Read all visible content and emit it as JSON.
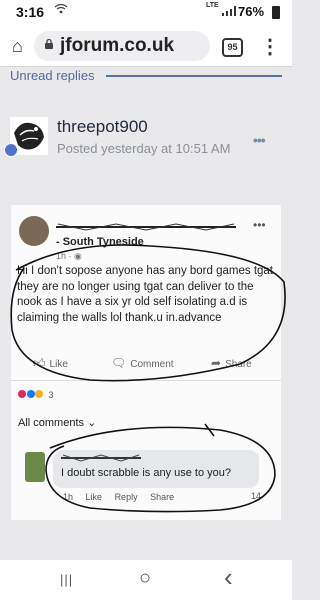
{
  "status_bar": {
    "time": "3:16",
    "network": "LTE",
    "battery": "76%",
    "wifi_icon": "wifi-icon",
    "signal_icon": "signal-icon",
    "battery_icon": "battery-icon"
  },
  "browser": {
    "url": "jforum.co.uk",
    "tab_count": "95",
    "home_icon": "home-icon",
    "lock_icon": "lock-icon",
    "menu_icon": "more-vert-icon"
  },
  "thread": {
    "unread_label": "Unread replies"
  },
  "post": {
    "author": "threepot900",
    "posted": "Posted yesterday at 10:51 AM",
    "options_icon": "ellipsis-icon"
  },
  "fb_screenshot": {
    "location": "- South Tyneside",
    "time": "1h · ",
    "text": "Hi I don't sopose anyone has any bord games tgat they are no longer using tgat can deliver to the nook as I have a six yr old self isolating a.d is claiming the walls lol  thank.u in.advance",
    "actions": [
      "Like",
      "Comment",
      "Share"
    ],
    "reaction_count": "3",
    "comments_filter": "All comments",
    "comment": {
      "text": "I doubt scrabble is any use to you?",
      "meta": [
        "1h",
        "Like",
        "Reply",
        "Share"
      ],
      "like_count": "14"
    }
  },
  "nav_bar": {
    "recent": "|||",
    "home": "○",
    "back": "‹"
  }
}
